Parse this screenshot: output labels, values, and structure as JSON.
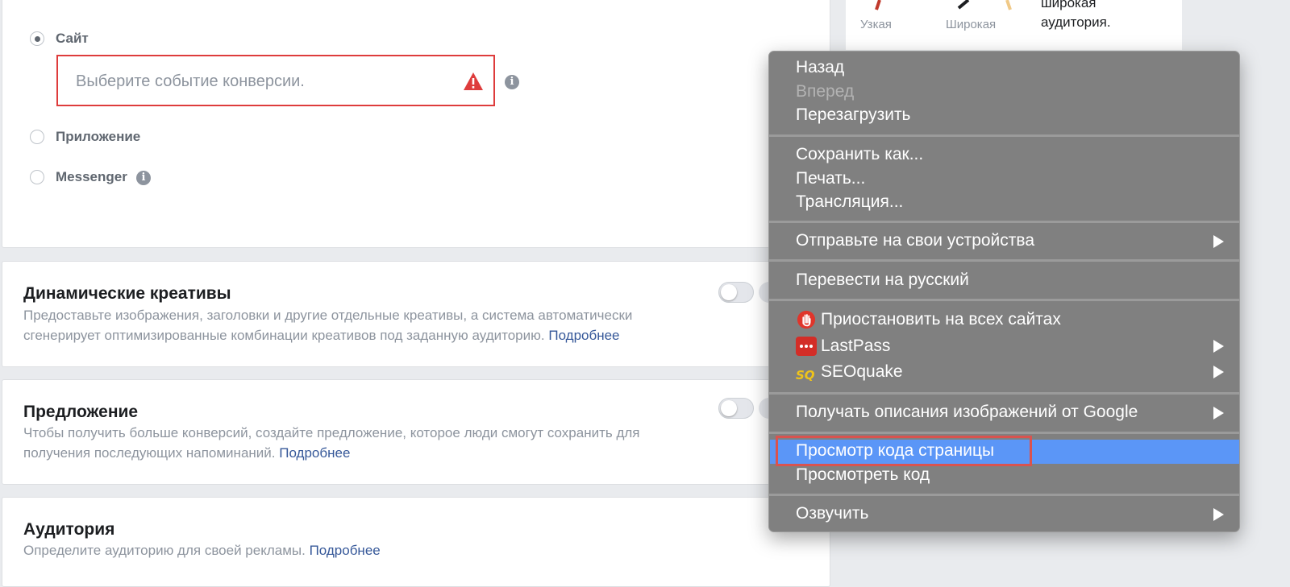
{
  "conversion": {
    "options": [
      {
        "label": "Сайт",
        "selected": true
      },
      {
        "label": "Приложение",
        "selected": false
      },
      {
        "label": "Messenger",
        "selected": false
      }
    ],
    "event_placeholder": "Выберите событие конверсии."
  },
  "sections": [
    {
      "title": "Динамические креативы",
      "desc_line1": "Предоставьте изображения, заголовки и другие отдельные креативы, а система автоматически",
      "desc_line2": "сгенерирует оптимизированные комбинации креативов под заданную аудиторию.",
      "link": "Подробнее",
      "toggle_on": false
    },
    {
      "title": "Предложение",
      "desc_line1": "Чтобы получить больше конверсий, создайте предложение, которое люди смогут сохранить для",
      "desc_line2": "получения последующих напоминаний.",
      "link": "Подробнее",
      "toggle_on": false
    },
    {
      "title": "Аудитория",
      "desc_line1": "Определите аудиторию для своей рекламы.",
      "link": "Подробнее"
    }
  ],
  "audience_panel": {
    "narrow": "Узкая",
    "wide": "Широкая",
    "desc_line1": "широкая",
    "desc_line2": "аудитория."
  },
  "context_menu": {
    "back": "Назад",
    "forward": "Вперед",
    "reload": "Перезагрузить",
    "save_as": "Сохранить как...",
    "print": "Печать...",
    "cast": "Трансляция...",
    "send_to_devices": "Отправьте на свои устройства",
    "translate": "Перевести на русский",
    "pause_all_sites": "Приостановить на всех сайтах",
    "lastpass": "LastPass",
    "seoquake": "SEOquake",
    "image_descriptions": "Получать описания изображений от Google",
    "view_source": "Просмотр кода страницы",
    "inspect": "Просмотреть код",
    "speech": "Озвучить"
  },
  "colors": {
    "error_red": "#de3c3c",
    "link_blue": "#365899",
    "menu_bg": "#808080",
    "menu_highlight": "#5b96f7"
  }
}
